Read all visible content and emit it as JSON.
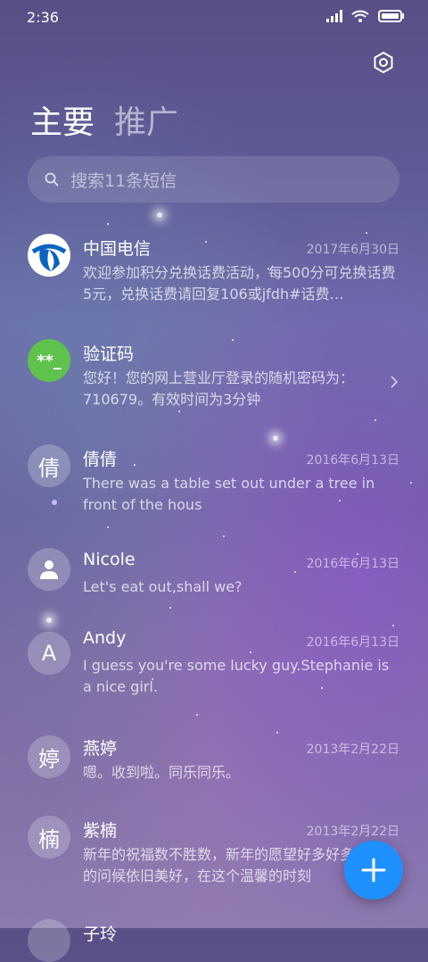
{
  "status_bar": {
    "time": "2:36"
  },
  "header": {
    "tabs": [
      {
        "label": "主要"
      },
      {
        "label": "推广"
      }
    ]
  },
  "search": {
    "placeholder": "搜索11条短信"
  },
  "conversations": [
    {
      "name": "中国电信",
      "date": "2017年6月30日",
      "preview": "欢迎参加积分兑换话费活动，每500分可兑换话费5元，兑换话费请回复106或jfdh#话费…",
      "avatar": "china-telecom-logo"
    },
    {
      "name": "验证码",
      "date": "",
      "preview": "您好！您的网上营业厅登录的随机密码为：710679。有效时间为3分钟",
      "avatar_text": "**_"
    },
    {
      "name": "倩倩",
      "date": "2016年6月13日",
      "preview": "There was a table set out under a tree in front of the hous",
      "avatar_text": "倩"
    },
    {
      "name": "Nicole",
      "date": "2016年6月13日",
      "preview": "Let's eat out,shall we?",
      "avatar": "person-icon"
    },
    {
      "name": "Andy",
      "date": "2016年6月13日",
      "preview": "I guess you're some lucky guy.Stephanie is a nice girl.",
      "avatar_text": "A"
    },
    {
      "name": "燕婷",
      "date": "2013年2月22日",
      "preview": "嗯。收到啦。同乐同乐。",
      "avatar_text": "婷"
    },
    {
      "name": "紫楠",
      "date": "2013年2月22日",
      "preview": "新年的祝福数不胜数，新年的愿望好多好多，新年的问候依旧美好，在这个温馨的时刻",
      "avatar_text": "楠"
    },
    {
      "name": "子玲",
      "date": "",
      "preview": "",
      "avatar_text": ""
    }
  ],
  "colors": {
    "fab": "#1e90ff",
    "verify_avatar": "#5fc24d",
    "telecom_blue": "#0a64c4"
  }
}
